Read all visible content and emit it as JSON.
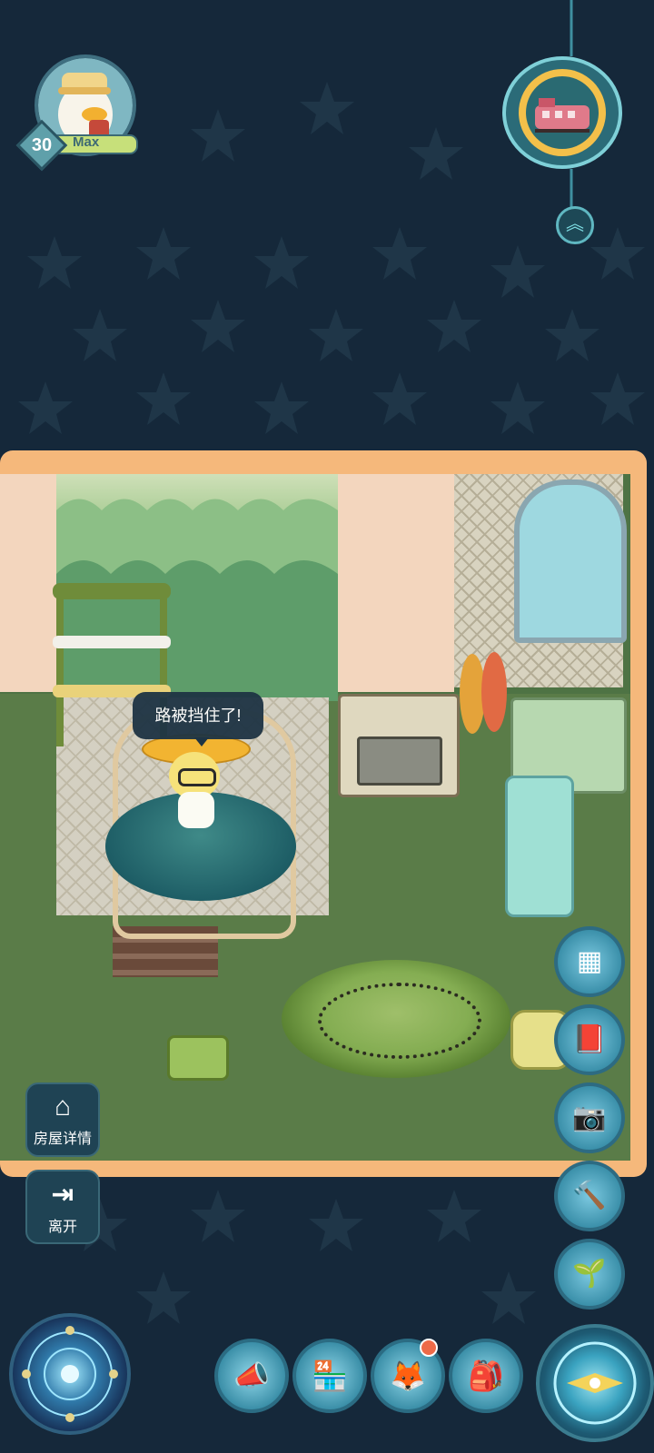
{
  "player": {
    "level": "30",
    "name": "Max"
  },
  "speech_bubble": {
    "text": "路被挡住了!"
  },
  "house_buttons": {
    "details_label": "房屋详情",
    "leave_label": "离开"
  },
  "side_buttons": [
    {
      "icon": "furniture-catalog-icon"
    },
    {
      "icon": "book-icon"
    },
    {
      "icon": "camera-icon"
    },
    {
      "icon": "hammer-icon"
    },
    {
      "icon": "sprout-icon"
    }
  ],
  "bottom_buttons": [
    {
      "icon": "megaphone-icon"
    },
    {
      "icon": "shop-icon"
    },
    {
      "icon": "fox-pet-icon",
      "has_notification": true
    },
    {
      "icon": "backpack-icon"
    }
  ],
  "colors": {
    "background": "#15283a",
    "room_frame": "#f5b87b",
    "floor": "#5a7c48",
    "notification": "#ee6a48"
  }
}
